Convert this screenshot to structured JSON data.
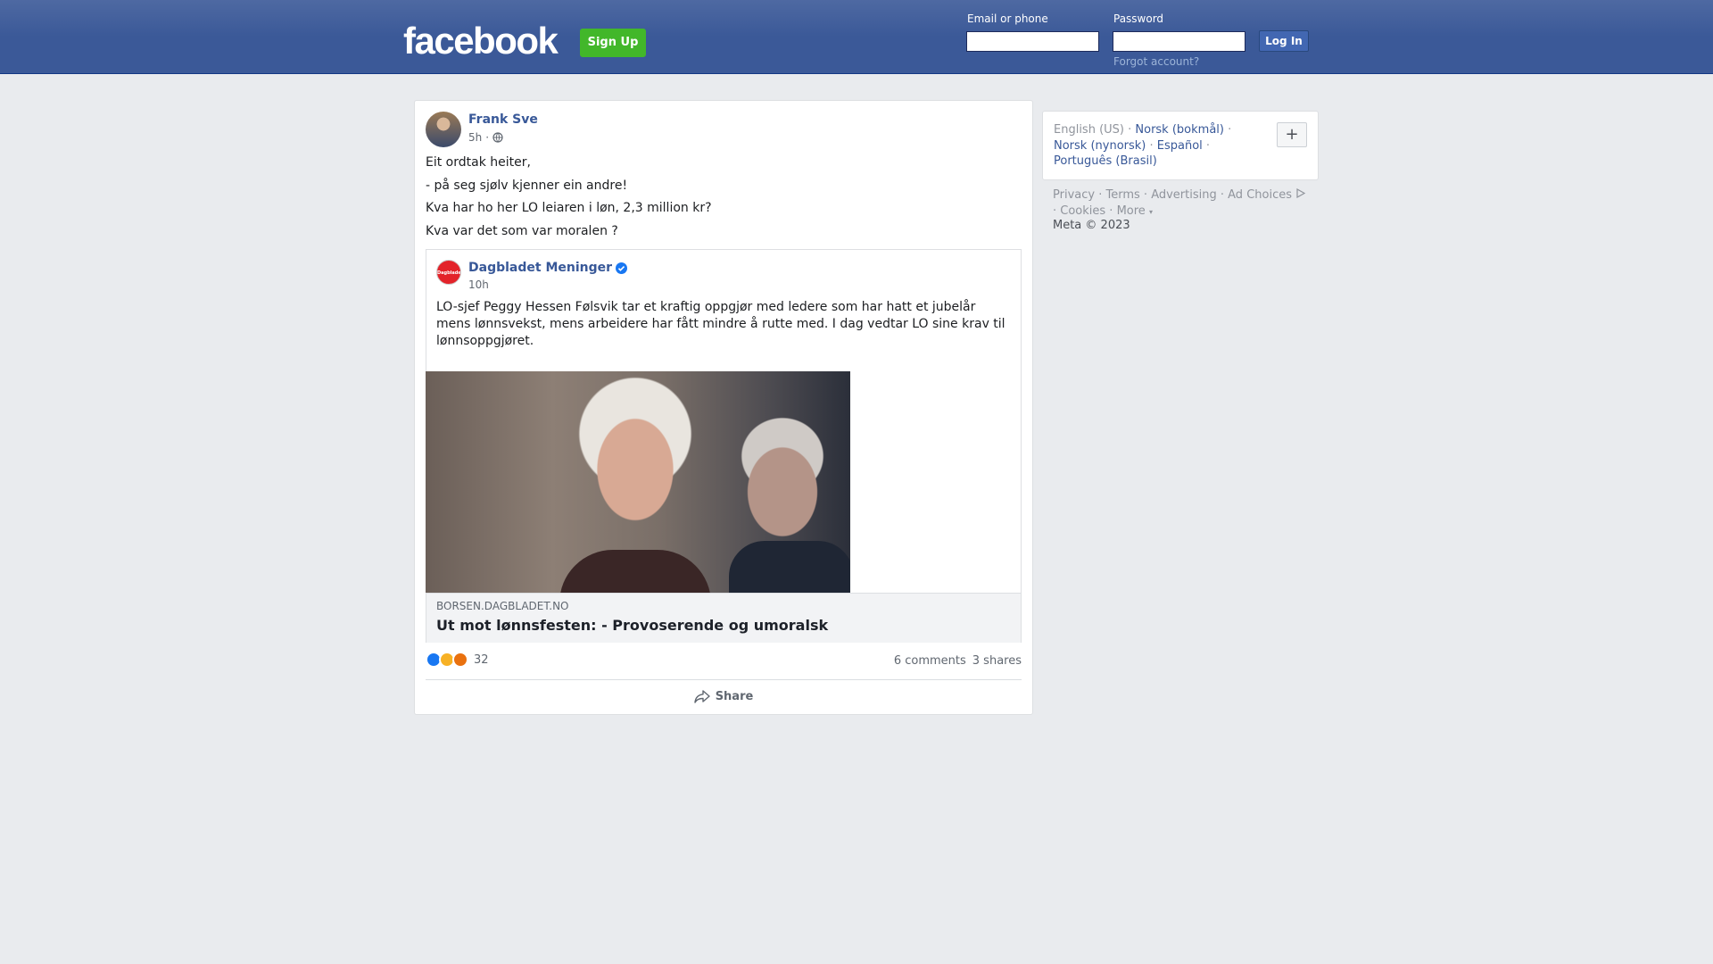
{
  "header": {
    "logo": "facebook",
    "signup_label": "Sign Up",
    "email_label": "Email or phone",
    "password_label": "Password",
    "login_label": "Log In",
    "forgot_label": "Forgot account?"
  },
  "post": {
    "author": "Frank Sve",
    "time": "5h",
    "dot": "·",
    "lines": [
      "Eit ordtak heiter,",
      "- på seg sjølv kjenner ein andre!",
      "Kva har ho her LO leiaren i løn, 2,3 million kr?",
      "Kva var det som var moralen ?"
    ],
    "shared": {
      "page_name": "Dagbladet Meninger",
      "avatar_text": "Dagbladet",
      "time": "10h",
      "text": "LO-sjef Peggy Hessen Følsvik tar et kraftig oppgjør med ledere som har hatt et jubelår mens lønnsvekst, mens arbeidere har fått mindre å rutte med. I dag vedtar LO sine krav til lønnsoppgjøret.",
      "link_domain": "BORSEN.DAGBLADET.NO",
      "link_title": "Ut mot lønnsfesten: - Provoserende og umoralsk"
    },
    "reaction_count": "32",
    "comments": "6 comments",
    "shares": "3 shares",
    "share_label": "Share",
    "reaction_icons": [
      "like-icon",
      "haha-icon",
      "angry-icon"
    ],
    "colors": {
      "like": "#1877f2",
      "haha": "#f7b125",
      "angry": "#e9710f",
      "link": "#385898"
    }
  },
  "sidebar": {
    "current_language": "English (US)",
    "languages": [
      "Norsk (bokmål)",
      "Norsk (nynorsk)",
      "Español",
      "Português (Brasil)"
    ],
    "plus_label": "+",
    "footer": [
      "Privacy",
      "Terms",
      "Advertising",
      "Ad Choices",
      "Cookies",
      "More"
    ],
    "copyright": "Meta © 2023"
  }
}
